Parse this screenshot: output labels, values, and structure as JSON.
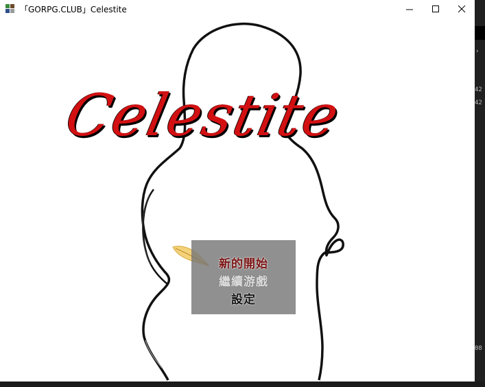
{
  "window": {
    "title": "「GORPG.CLUB」Celestite"
  },
  "game": {
    "logo_text": "Celestite",
    "menu": {
      "items": [
        {
          "label": "新的開始",
          "state": "selected"
        },
        {
          "label": "繼續游戲",
          "state": "normal"
        },
        {
          "label": "設定",
          "state": "normal"
        }
      ]
    }
  },
  "background": {
    "numbers": [
      "42",
      "42",
      "08"
    ]
  },
  "colors": {
    "logo_red": "#d21012",
    "selected_text": "#7a1414",
    "menu_panel": "#787878"
  }
}
